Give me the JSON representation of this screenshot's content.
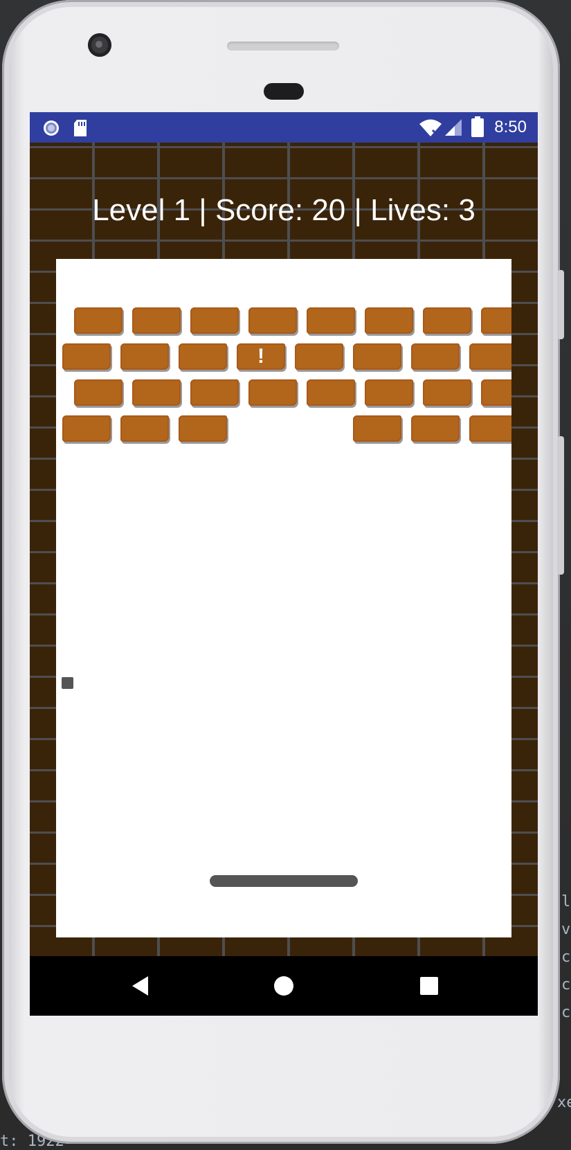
{
  "status_bar": {
    "time": "8:50",
    "left_icons": [
      "circle-dot-icon",
      "sd-card-icon"
    ],
    "right_icons": [
      "wifi-icon",
      "signal-icon",
      "battery-icon"
    ],
    "color": "#303f9f"
  },
  "hud": {
    "text": "Level 1 | Score: 20 | Lives: 3"
  },
  "game": {
    "brick_color": "#b1661b",
    "playfield_color": "#ffffff",
    "special_brick_symbol": "!",
    "brick_rows": [
      [
        true,
        true,
        true,
        true,
        true,
        true,
        true,
        true
      ],
      [
        true,
        true,
        true,
        true,
        true,
        true,
        true,
        true
      ],
      [
        true,
        true,
        true,
        true,
        true,
        true,
        true,
        true
      ],
      [
        true,
        true,
        true,
        false,
        false,
        true,
        true,
        true
      ]
    ]
  },
  "navbar": {
    "buttons": [
      "back-icon",
      "home-icon",
      "recents-icon"
    ]
  },
  "ide": {
    "bottom_text": "t: 1922",
    "right_text": [
      "l",
      "v",
      "c",
      "c",
      "c",
      "xe"
    ]
  }
}
